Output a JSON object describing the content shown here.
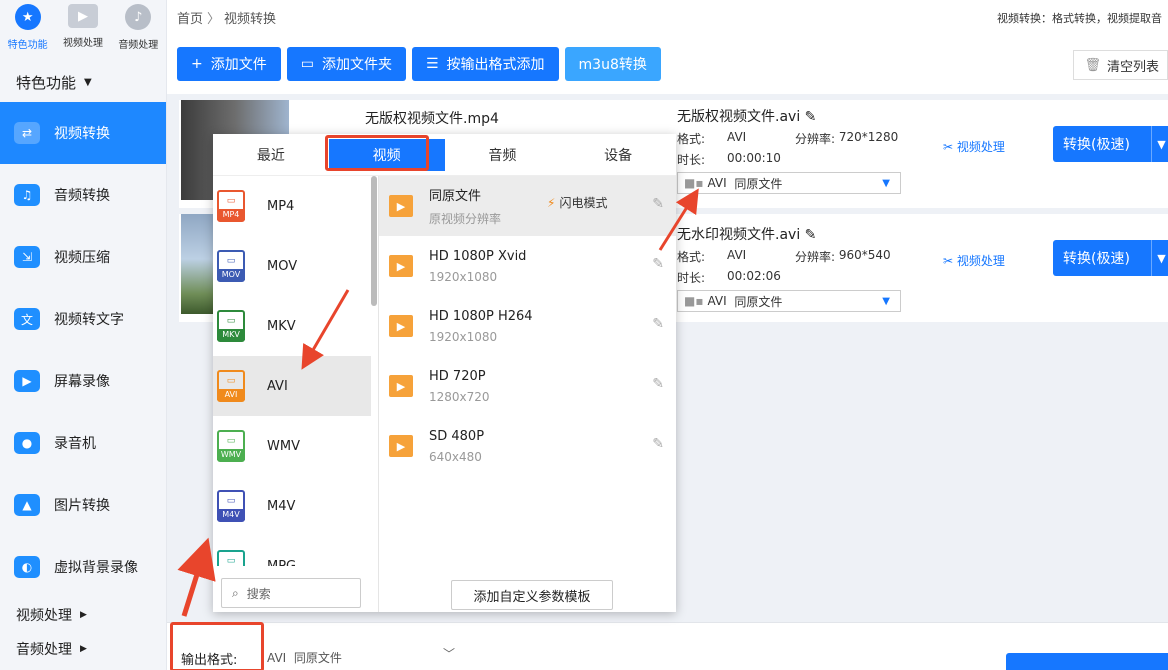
{
  "sidebar": {
    "top_tabs": [
      {
        "label": "特色功能",
        "icon": "star-icon"
      },
      {
        "label": "视频处理",
        "icon": "film-icon"
      },
      {
        "label": "音频处理",
        "icon": "music-icon"
      }
    ],
    "section_title": "特色功能",
    "items": [
      {
        "label": "视频转换",
        "color": "#ffffff"
      },
      {
        "label": "音频转换",
        "color": "#1f8fff"
      },
      {
        "label": "视频压缩",
        "color": "#1f8fff"
      },
      {
        "label": "视频转文字",
        "color": "#1f8fff"
      },
      {
        "label": "屏幕录像",
        "color": "#1f8fff"
      },
      {
        "label": "录音机",
        "color": "#1f8fff"
      },
      {
        "label": "图片转换",
        "color": "#1f8fff"
      },
      {
        "label": "虚拟背景录像",
        "color": "#1f8fff"
      }
    ],
    "bottom_sections": [
      "视频处理",
      "音频处理"
    ]
  },
  "breadcrumb": {
    "home": "首页",
    "current": "视频转换"
  },
  "header_right": "视频转换：格式转换，视频提取音",
  "toolbar": {
    "add_file": "添加文件",
    "add_folder": "添加文件夹",
    "add_by_format": "按输出格式添加",
    "m3u8": "m3u8转换",
    "clear_list": "清空列表"
  },
  "files": [
    {
      "name": "无版权视频文件.mp4",
      "out_name": "无版权视频文件.avi",
      "format_label": "格式:",
      "format": "AVI",
      "res_label": "分辨率:",
      "resolution": "720*1280",
      "duration_label": "时长:",
      "duration": "00:00:10",
      "out_format": "AVI",
      "out_preset": "同原文件",
      "video_process": "视频处理",
      "convert": "转换(极速)"
    },
    {
      "name": "",
      "out_name": "无水印视频文件.avi",
      "format_label": "格式:",
      "format": "AVI",
      "res_label": "分辨率:",
      "resolution": "960*540",
      "duration_label": "时长:",
      "duration": "00:02:06",
      "out_format": "AVI",
      "out_preset": "同原文件",
      "video_process": "视频处理",
      "convert": "转换(极速)"
    }
  ],
  "popup": {
    "tabs": [
      "最近",
      "视频",
      "音频",
      "设备"
    ],
    "active_tab": "视频",
    "formats": [
      {
        "name": "MP4",
        "color": "#e9572f"
      },
      {
        "name": "MOV",
        "color": "#3c5bb3"
      },
      {
        "name": "MKV",
        "color": "#2d8a3b"
      },
      {
        "name": "AVI",
        "color": "#f08a1c"
      },
      {
        "name": "WMV",
        "color": "#4caf50"
      },
      {
        "name": "M4V",
        "color": "#3f51b5"
      },
      {
        "name": "MPG",
        "color": "#19a38e"
      }
    ],
    "selected_format": "AVI",
    "presets": [
      {
        "name": "同原文件",
        "sub": "原视频分辨率",
        "flash": "闪电模式"
      },
      {
        "name": "HD 1080P Xvid",
        "sub": "1920x1080"
      },
      {
        "name": "HD 1080P H264",
        "sub": "1920x1080"
      },
      {
        "name": "HD 720P",
        "sub": "1280x720"
      },
      {
        "name": "SD 480P",
        "sub": "640x480"
      }
    ],
    "search_placeholder": "搜索",
    "custom_template": "添加自定义参数模板"
  },
  "bottom": {
    "label": "输出格式:",
    "format": "AVI",
    "preset": "同原文件"
  },
  "accent_color": "#1677ff",
  "annotation_color": "#e8452c"
}
